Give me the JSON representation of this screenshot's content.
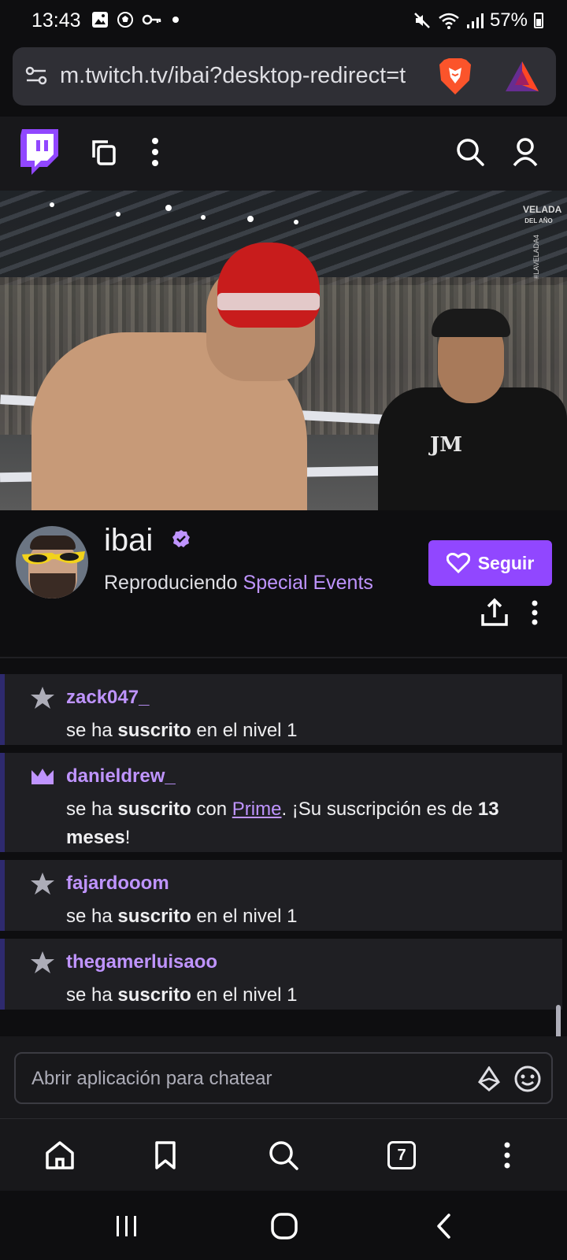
{
  "status_bar": {
    "time": "13:43",
    "battery": "57%",
    "left_icons": [
      "image-icon",
      "soccer-ball-icon",
      "key-icon",
      "dot-icon"
    ],
    "right_icons": [
      "mute-icon",
      "wifi-icon",
      "signal-icon",
      "battery-icon"
    ]
  },
  "browser": {
    "url": "m.twitch.tv/ibai?desktop-redirect=t",
    "tab_count": "7"
  },
  "channel": {
    "name": "ibai",
    "playing_prefix": "Reproduciendo",
    "category": "Special Events",
    "follow_label": "Seguir"
  },
  "video": {
    "watermark": "VELADA",
    "watermark_sub": "DEL AÑO",
    "tag": "#LAVELADA4",
    "shirt_mark": "JM"
  },
  "chat": {
    "messages": [
      {
        "icon": "star-icon",
        "user": "zack047_",
        "pre": "se ha ",
        "bold": "suscrito",
        "post": " en el nivel 1"
      },
      {
        "icon": "crown-icon",
        "user": "danieldrew_",
        "pre": "se ha ",
        "bold": "suscrito",
        "mid": " con ",
        "link": "Prime",
        "post": ". ¡Su suscripción es de ",
        "bold2": "13 meses",
        "end": "!"
      },
      {
        "icon": "star-icon",
        "user": "fajardooom",
        "pre": "se ha ",
        "bold": "suscrito",
        "post": " en el nivel 1"
      },
      {
        "icon": "star-icon",
        "user": "thegamerluisaoo",
        "pre": "se ha ",
        "bold": "suscrito",
        "post": " en el nivel 1"
      }
    ],
    "input_placeholder": "Abrir aplicación para chatear"
  },
  "colors": {
    "accent": "#9147ff",
    "accent_light": "#bf94ff",
    "background": "#0e0e10",
    "surface": "#1f1f23"
  }
}
